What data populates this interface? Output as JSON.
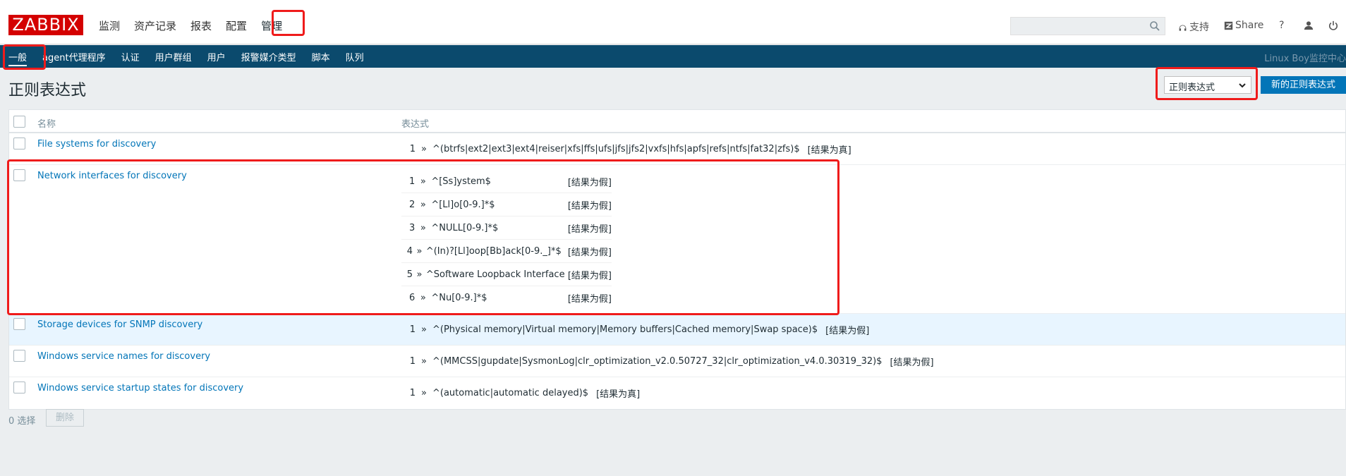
{
  "brand": "ZABBIX",
  "main_nav": [
    "监测",
    "资产记录",
    "报表",
    "配置",
    "管理"
  ],
  "top_right": {
    "support": "支持",
    "share": "Share",
    "help": "?"
  },
  "sub_nav": [
    "一般",
    "agent代理程序",
    "认证",
    "用户群组",
    "用户",
    "报警媒介类型",
    "脚本",
    "队列"
  ],
  "sub_nav_right": "Linux Boy监控中心",
  "page_title": "正则表达式",
  "view_select": {
    "selected": "正则表达式"
  },
  "create_button": "新的正则表达式",
  "table": {
    "headers": {
      "name": "名称",
      "expression": "表达式"
    },
    "rows": [
      {
        "name": "File systems for discovery",
        "expressions": [
          {
            "n": "1",
            "arrow": "»",
            "text": "^(btrfs|ext2|ext3|ext4|reiser|xfs|ffs|ufs|jfs|jfs2|vxfs|hfs|apfs|refs|ntfs|fat32|zfs)$",
            "result": "[结果为真]"
          }
        ]
      },
      {
        "name": "Network interfaces for discovery",
        "expressions": [
          {
            "n": "1",
            "arrow": "»",
            "text": "^[Ss]ystem$",
            "result": "[结果为假]"
          },
          {
            "n": "2",
            "arrow": "»",
            "text": "^[Ll]o[0-9.]*$",
            "result": "[结果为假]"
          },
          {
            "n": "3",
            "arrow": "»",
            "text": "^NULL[0-9.]*$",
            "result": "[结果为假]"
          },
          {
            "n": "4",
            "arrow": "»",
            "text": "^(In)?[Ll]oop[Bb]ack[0-9._]*$",
            "result": "[结果为假]"
          },
          {
            "n": "5",
            "arrow": "»",
            "text": "^Software Loopback Interface",
            "result": "[结果为假]"
          },
          {
            "n": "6",
            "arrow": "»",
            "text": "^Nu[0-9.]*$",
            "result": "[结果为假]"
          }
        ]
      },
      {
        "name": "Storage devices for SNMP discovery",
        "expressions": [
          {
            "n": "1",
            "arrow": "»",
            "text": "^(Physical memory|Virtual memory|Memory buffers|Cached memory|Swap space)$",
            "result": "[结果为假]"
          }
        ]
      },
      {
        "name": "Windows service names for discovery",
        "expressions": [
          {
            "n": "1",
            "arrow": "»",
            "text": "^(MMCSS|gupdate|SysmonLog|clr_optimization_v2.0.50727_32|clr_optimization_v4.0.30319_32)$",
            "result": "[结果为假]"
          }
        ]
      },
      {
        "name": "Windows service startup states for discovery",
        "expressions": [
          {
            "n": "1",
            "arrow": "»",
            "text": "^(automatic|automatic delayed)$",
            "result": "[结果为真]"
          }
        ]
      }
    ]
  },
  "footer": {
    "selected": "0 选择",
    "delete": "删除"
  },
  "colors": {
    "brand_red": "#d40000",
    "nav_blue": "#0b4a6d",
    "link": "#0275b8",
    "annotation": "#ef1b1b"
  }
}
